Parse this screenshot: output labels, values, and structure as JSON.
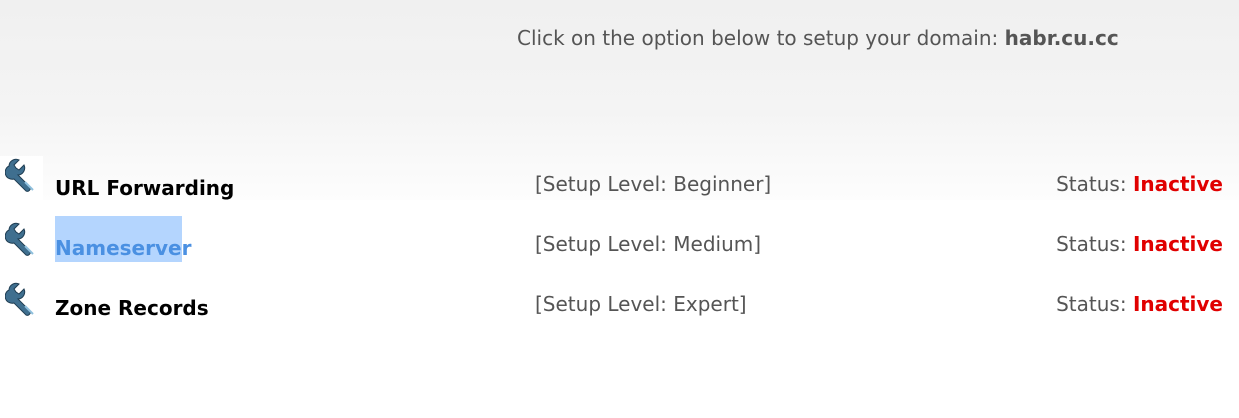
{
  "header": {
    "intro_text": "Click on the option below to setup your domain: ",
    "domain": "habr.cu.cc"
  },
  "options": [
    {
      "icon": "wrench-icon",
      "name": "URL Forwarding",
      "level": "[Setup Level: Beginner]",
      "status_label": "Status: ",
      "status_value": "Inactive"
    },
    {
      "icon": "wrench-icon",
      "name": "Nameserver",
      "level": "[Setup Level: Medium]",
      "status_label": "Status: ",
      "status_value": "Inactive"
    },
    {
      "icon": "wrench-icon",
      "name": "Zone Records",
      "level": "[Setup Level: Expert]",
      "status_label": "Status: ",
      "status_value": "Inactive"
    }
  ],
  "colors": {
    "status_inactive": "#e00000",
    "selection_highlight": "#b4d5fe",
    "selected_link": "#4a90e2",
    "text_gray": "#555555"
  }
}
